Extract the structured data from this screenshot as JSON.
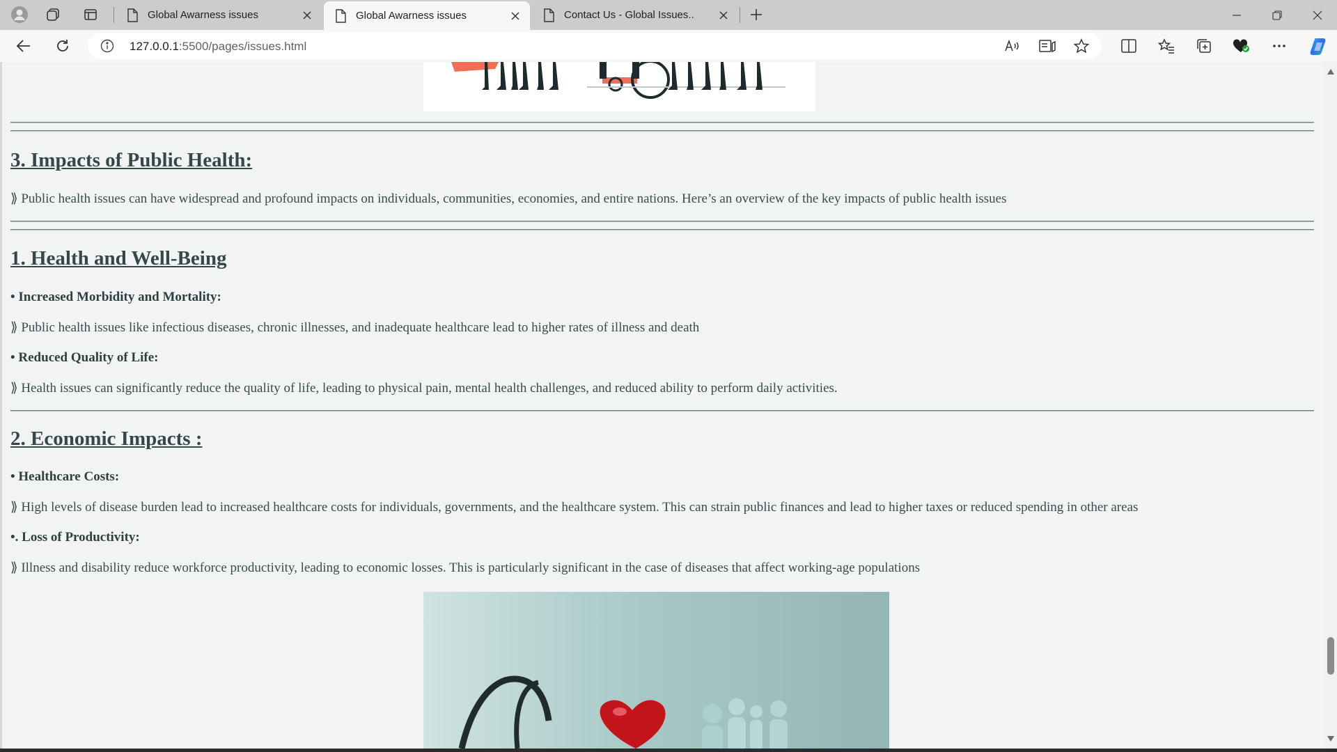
{
  "browser": {
    "tabs": [
      {
        "title": "Global Awarness issues",
        "active": false
      },
      {
        "title": "Global Awarness issues",
        "active": true
      },
      {
        "title": "Contact Us - Global Issues..",
        "active": false
      }
    ],
    "url_host": "127.0.0.1",
    "url_rest": ":5500/pages/issues.html",
    "accent_color": "#1a73e8"
  },
  "page": {
    "section3_title": "3. Impacts of Public Health:",
    "section3_text": "⟫ Public health issues can have widespread and profound impacts on individuals, communities, economies, and entire nations. Here’s an overview of the key impacts of public health issues",
    "health_title": "1. Health and Well-Being",
    "health_items": [
      {
        "heading": "• Increased Morbidity and Mortality:",
        "text": "⟫ Public health issues like infectious diseases, chronic illnesses, and inadequate healthcare lead to higher rates of illness and death"
      },
      {
        "heading": "• Reduced Quality of Life:",
        "text": "⟫ Health issues can significantly reduce the quality of life, leading to physical pain, mental health challenges, and reduced ability to perform daily activities."
      }
    ],
    "economic_title": "2. Economic Impacts :",
    "economic_items": [
      {
        "heading": "• Healthcare Costs:",
        "text": "⟫ High levels of disease burden lead to increased healthcare costs for individuals, governments, and the healthcare system. This can strain public finances and lead to higher taxes or reduced spending in other areas"
      },
      {
        "heading": "•. Loss of Productivity:",
        "text": "⟫ Illness and disability reduce workforce productivity, leading to economic losses. This is particularly significant in the case of diseases that affect working-age populations"
      }
    ]
  }
}
